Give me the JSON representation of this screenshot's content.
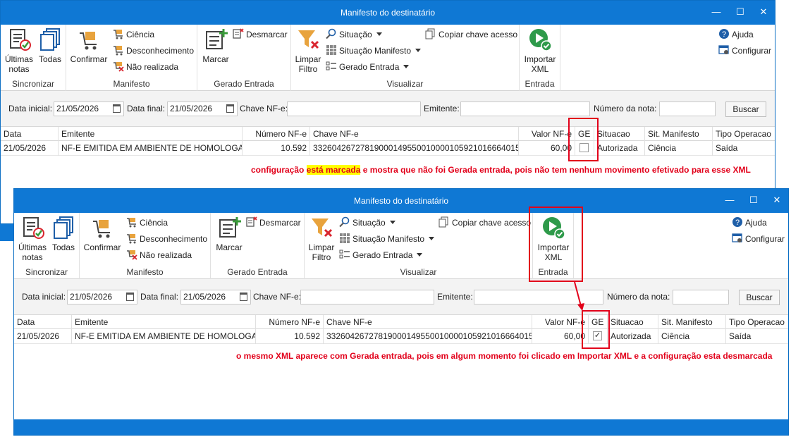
{
  "window_title": "Manifesto do destinatário",
  "window_controls": {
    "minimize": "—",
    "maximize": "☐",
    "close": "✕"
  },
  "ribbon": {
    "sincronizar": {
      "label": "Sincronizar",
      "ultimas": "Últimas notas",
      "todas": "Todas"
    },
    "manifesto": {
      "label": "Manifesto",
      "confirmar": "Confirmar",
      "ciencia": "Ciência",
      "desconhecimento": "Desconhecimento",
      "nao_realizada": "Não realizada"
    },
    "gerado": {
      "label": "Gerado Entrada",
      "marcar": "Marcar",
      "desmarcar": "Desmarcar"
    },
    "visualizar": {
      "label": "Visualizar",
      "limpar": "Limpar Filtro",
      "situacao": "Situação",
      "situacao_manifesto": "Situação Manifesto",
      "gerado_entrada": "Gerado Entrada",
      "copiar": "Copiar chave acesso"
    },
    "entrada": {
      "label": "Entrada",
      "importar": "Importar XML"
    },
    "ajuda": "Ajuda",
    "configurar": "Configurar"
  },
  "filters": {
    "data_inicial_label": "Data inicial:",
    "data_inicial": "21/05/2026",
    "data_final_label": "Data final:",
    "data_final": "21/05/2026",
    "chave_label": "Chave NF-e:",
    "emitente_label": "Emitente:",
    "numero_label": "Número da nota:",
    "buscar": "Buscar"
  },
  "grid": {
    "headers": {
      "data": "Data",
      "emitente": "Emitente",
      "numero": "Número NF-e",
      "chave": "Chave NF-e",
      "valor": "Valor NF-e",
      "ge": "GE",
      "situacao": "Situacao",
      "sit_manifesto": "Sit. Manifesto",
      "tipo": "Tipo Operacao"
    },
    "row": {
      "data": "21/05/2026",
      "emitente": "NF-E EMITIDA EM AMBIENTE DE HOMOLOGA...",
      "numero": "10.592",
      "chave": "33260426727819000149550010000105921016664015",
      "valor": "60,00",
      "situacao": "Autorizada",
      "sit_manifesto": "Ciência",
      "tipo": "Saída"
    }
  },
  "window1": {
    "ge_checked": false
  },
  "window2": {
    "ge_checked": true,
    "checkmark": "✓"
  },
  "notes": {
    "top_pre": "configuração ",
    "top_hl": "está marcada",
    "top_post": " e mostra que não foi Gerada entrada, pois não tem nenhum movimento efetivado para esse XML",
    "bottom": "o mesmo XML aparece com Gerada entrada, pois em algum momento foi clicado em Importar XML e a configuração esta desmarcada"
  },
  "colors": {
    "titlebar": "#0f78d4",
    "note_red": "#e2001a",
    "highlight": "#ffff00"
  }
}
